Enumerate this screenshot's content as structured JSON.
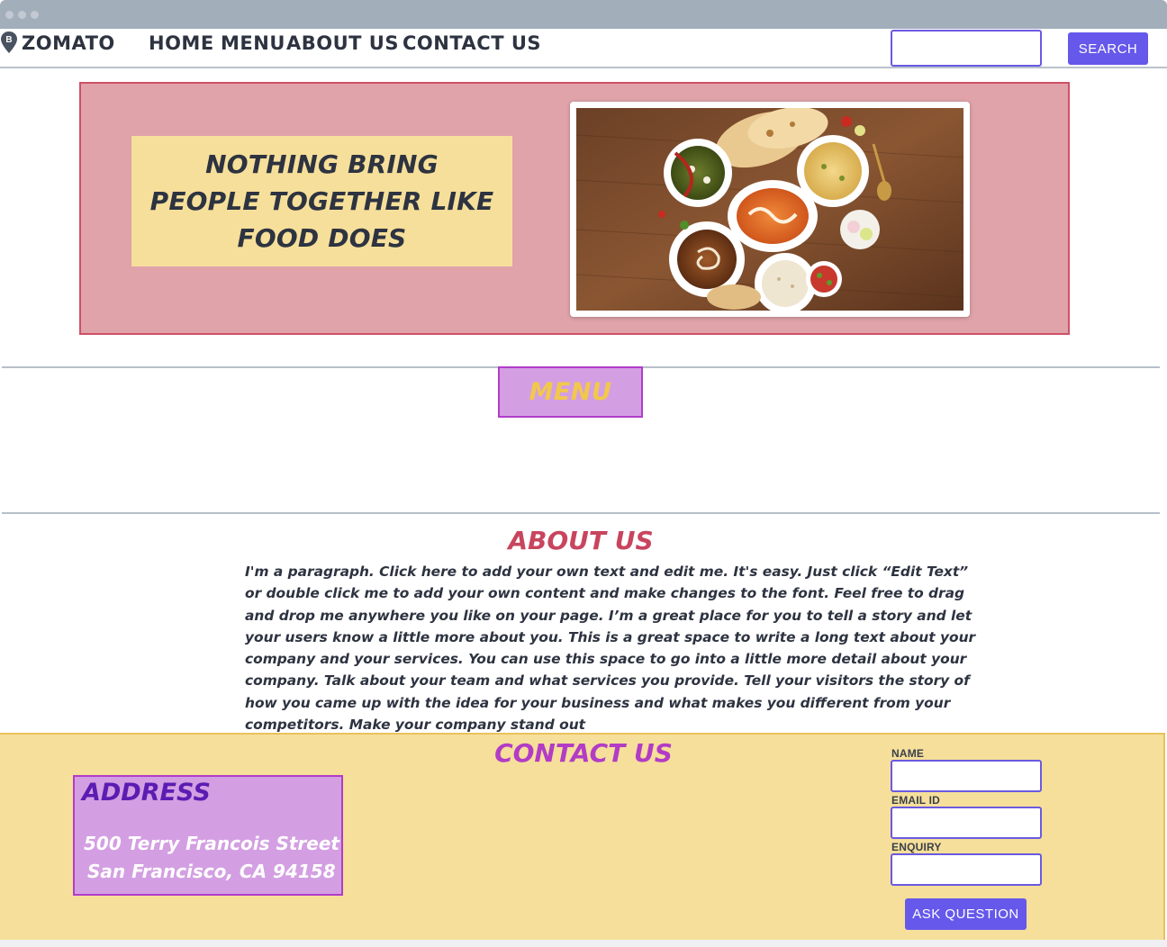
{
  "window": {
    "chrome": "browser-window"
  },
  "navbar": {
    "brand": "ZOMATO",
    "brand_icon": "map-pin-icon",
    "brand_icon_letter": "B",
    "links": [
      "HOME",
      "MENU",
      "ABOUT US",
      "CONTACT US"
    ],
    "search_value": "",
    "search_button": "SEARCH"
  },
  "hero": {
    "tagline": "NOTHING BRING\nPEOPLE TOGETHER LIKE\nFOOD DOES",
    "image_alt": "indian-food-spread-photo"
  },
  "menu_section": {
    "title": "MENU"
  },
  "about": {
    "title": "ABOUT US",
    "paragraph": "I'm a paragraph. Click here to add your own text and edit me. It's easy. Just click “Edit Text” or double click me to add your own content and make changes to the font. Feel free to drag and drop me anywhere you like on your page. I’m a great place for you to tell a story and let your users know a little more about you. This is a great space to write a long text about your company and your services. You can use this space to go into a little more detail about your company. Talk about your team and what services you provide. Tell your visitors the story of how you came up with the idea for your business and what makes you different from your competitors. Make your company stand out"
  },
  "contact": {
    "title": "CONTACT US",
    "address_title": "ADDRESS",
    "address_line1": "500 Terry Francois Street",
    "address_line2": "San Francisco, CA 94158",
    "form": {
      "name_label": "NAME",
      "name_value": "",
      "email_label": "EMAIL ID",
      "email_value": "",
      "enquiry_label": "ENQUIRY",
      "enquiry_value": "",
      "submit": "ASK QUESTION"
    }
  },
  "colors": {
    "accent": "#6658ea",
    "hero_bg": "#dfa3a9",
    "hero_border": "#cf5068",
    "tagline_bg": "#f6df9a",
    "menu_bg": "#d39fe2",
    "menu_text": "#f2c84a",
    "about_title": "#c8455e",
    "contact_bg": "#f6df9a",
    "contact_title": "#b23cc6",
    "address_title": "#5b1cb2"
  }
}
